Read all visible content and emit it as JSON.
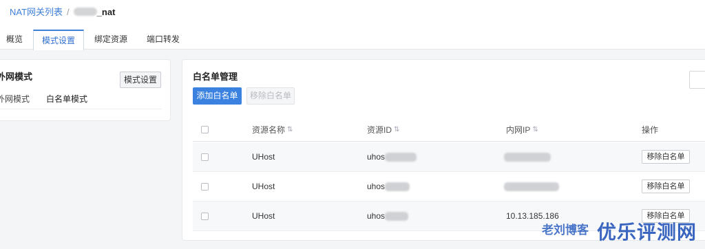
{
  "breadcrumb": {
    "parent": "NAT网关列表",
    "separator": "/",
    "current": "_nat"
  },
  "tabs": [
    {
      "label": "概览",
      "active": false
    },
    {
      "label": "模式设置",
      "active": true
    },
    {
      "label": "绑定资源",
      "active": false
    },
    {
      "label": "端口转发",
      "active": false
    }
  ],
  "mode_card": {
    "title": "外网模式",
    "button": "模式设置",
    "field_label": "外网模式",
    "field_value": "白名单模式"
  },
  "whitelist": {
    "title": "白名单管理",
    "add_button": "添加白名单",
    "remove_button": "移除白名单",
    "columns": [
      "资源名称",
      "资源ID",
      "内网IP",
      "操作"
    ],
    "rows": [
      {
        "name": "UHost",
        "id": "uhos",
        "ip": "",
        "action": "移除白名单"
      },
      {
        "name": "UHost",
        "id": "uhos",
        "ip": "",
        "action": "移除白名单"
      },
      {
        "name": "UHost",
        "id": "uhos",
        "ip": "10.13.185.186",
        "action": "移除白名单"
      }
    ]
  },
  "watermark": {
    "small": "老刘博客",
    "big": "优乐评测网"
  },
  "colors": {
    "accent": "#3b82e0",
    "link": "#3e7fd8",
    "watermark": "#3a66c0"
  }
}
